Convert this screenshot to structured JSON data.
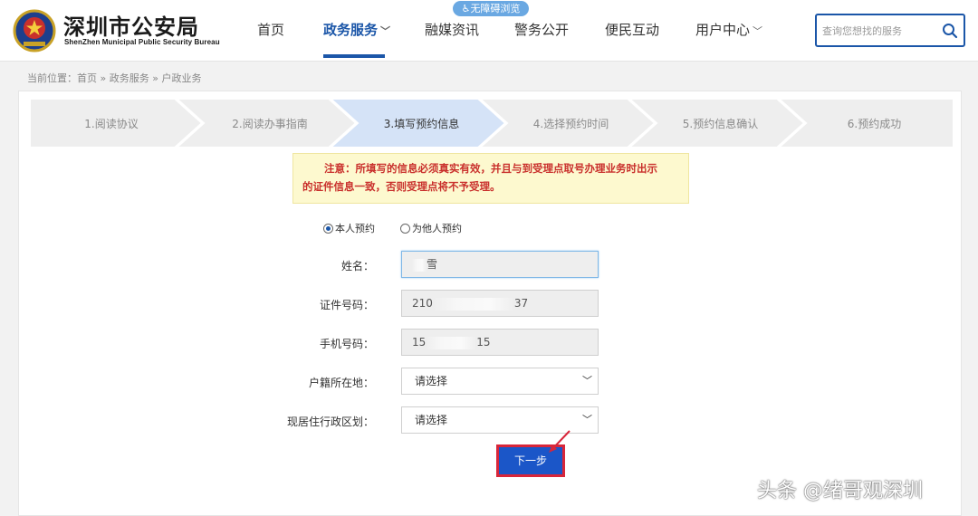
{
  "header": {
    "site_title": "深圳市公安局",
    "site_subtitle": "ShenZhen Municipal Public Security Bureau",
    "accessibility_badge": "无障碍浏览",
    "nav": [
      {
        "label": "首页",
        "active": false,
        "dropdown": false
      },
      {
        "label": "政务服务",
        "active": true,
        "dropdown": true
      },
      {
        "label": "融媒资讯",
        "active": false,
        "dropdown": false
      },
      {
        "label": "警务公开",
        "active": false,
        "dropdown": false
      },
      {
        "label": "便民互动",
        "active": false,
        "dropdown": false
      },
      {
        "label": "用户中心",
        "active": false,
        "dropdown": true
      }
    ],
    "search_placeholder": "查询您想找的服务"
  },
  "breadcrumb": "当前位置：首页 » 政务服务 » 户政业务",
  "steps": [
    {
      "label": "1.阅读协议",
      "active": false
    },
    {
      "label": "2.阅读办事指南",
      "active": false
    },
    {
      "label": "3.填写预约信息",
      "active": true
    },
    {
      "label": "4.选择预约时间",
      "active": false
    },
    {
      "label": "5.预约信息确认",
      "active": false
    },
    {
      "label": "6.预约成功",
      "active": false
    }
  ],
  "notice": {
    "line1": "注意：所填写的信息必须真实有效，并且与到受理点取号办理业务时出示",
    "line2": "的证件信息一致，否则受理点将不予受理。"
  },
  "booking_type": {
    "self_label": "本人预约",
    "other_label": "为他人预约",
    "selected": "self"
  },
  "form": {
    "name_label": "姓名：",
    "name_value_end": "雪",
    "id_label": "证件号码：",
    "id_value_start": "210",
    "id_value_end": "37",
    "phone_label": "手机号码：",
    "phone_value_start": "15",
    "phone_value_end": "15",
    "hukou_label": "户籍所在地：",
    "hukou_value": "请选择",
    "district_label": "现居住行政区划：",
    "district_value": "请选择"
  },
  "next_button": "下一步",
  "watermark": "头条 @绪哥观深圳",
  "colors": {
    "brand_blue": "#1b56a8",
    "active_step": "#d5e3f7",
    "step_bg": "#eeeeee",
    "notice_bg": "#fdf9cf",
    "notice_text": "#c9302c",
    "highlight_red": "#d8263a"
  }
}
